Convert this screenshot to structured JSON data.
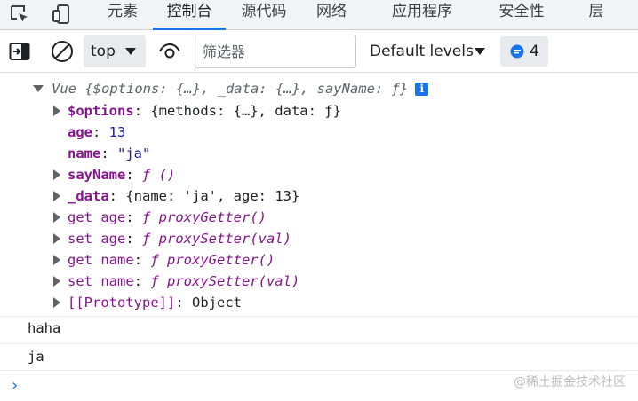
{
  "tabs": [
    {
      "label": "元素"
    },
    {
      "label": "控制台",
      "active": true
    },
    {
      "label": "源代码"
    },
    {
      "label": "网络"
    },
    {
      "label": "应用程序"
    },
    {
      "label": "安全性"
    },
    {
      "label": "层"
    }
  ],
  "toolbar": {
    "context": "top",
    "filter_placeholder": "筛选器",
    "levels": "Default levels",
    "issues_count": "4"
  },
  "console": {
    "object": {
      "summary_prefix": "Vue ",
      "summary_body": "{$options: {…}, _data: {…}, sayName: ƒ}",
      "info_badge": "i",
      "props": {
        "options_key": "$options",
        "options_value": "{methods: {…}, data: ƒ}",
        "age_key": "age",
        "age_value": "13",
        "name_key": "name",
        "name_value": "\"ja\"",
        "sayName_key": "sayName",
        "sayName_value": "ƒ ()",
        "data_key": "_data",
        "data_value": "{name: 'ja', age: 13}",
        "get_age_key": "get age",
        "get_age_value": "ƒ proxyGetter()",
        "set_age_key": "set age",
        "set_age_value": "ƒ proxySetter(val)",
        "get_name_key": "get name",
        "get_name_value": "ƒ proxyGetter()",
        "set_name_key": "set name",
        "set_name_value": "ƒ proxySetter(val)",
        "proto_key": "[[Prototype]]",
        "proto_value": "Object"
      }
    },
    "logs": [
      "haha",
      "ja"
    ],
    "prompt": "›"
  },
  "watermark": "@稀土掘金技术社区",
  "colors": {
    "accent": "#1a73e8",
    "key_purple": "#881391",
    "value_blue": "#1a1aa6"
  }
}
